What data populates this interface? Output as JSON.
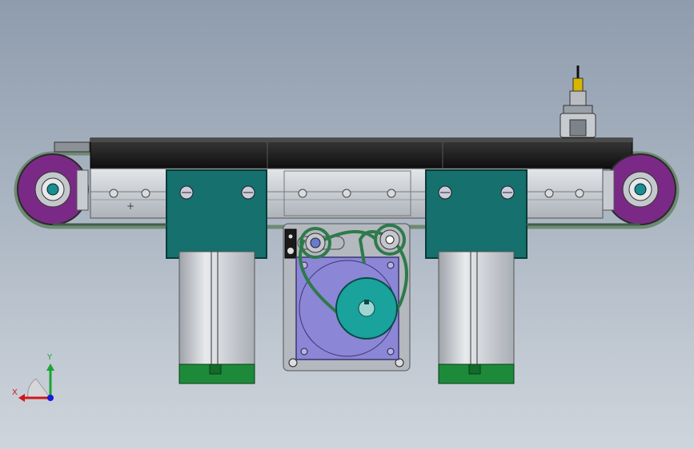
{
  "viewport": {
    "background_top": "#8f9cad",
    "background_bottom": "#cfd5dc"
  },
  "model": {
    "belt_color": "#1a1a1a",
    "frame_color": "#c8ccd2",
    "bracket_color": "#15706e",
    "pulley_color": "#7a2a86",
    "motor_plate_color": "#8c86d6",
    "drive_pulley_color": "#1aa29c",
    "cylinder_color": "#c9cdd3",
    "cylinder_cap_color": "#1d8a3a",
    "sensor_present": true
  },
  "triad": {
    "y_label": "Y",
    "x_label": "X",
    "y_color": "#1aa336",
    "x_color": "#d01818",
    "z_color": "#1a1ad8"
  }
}
